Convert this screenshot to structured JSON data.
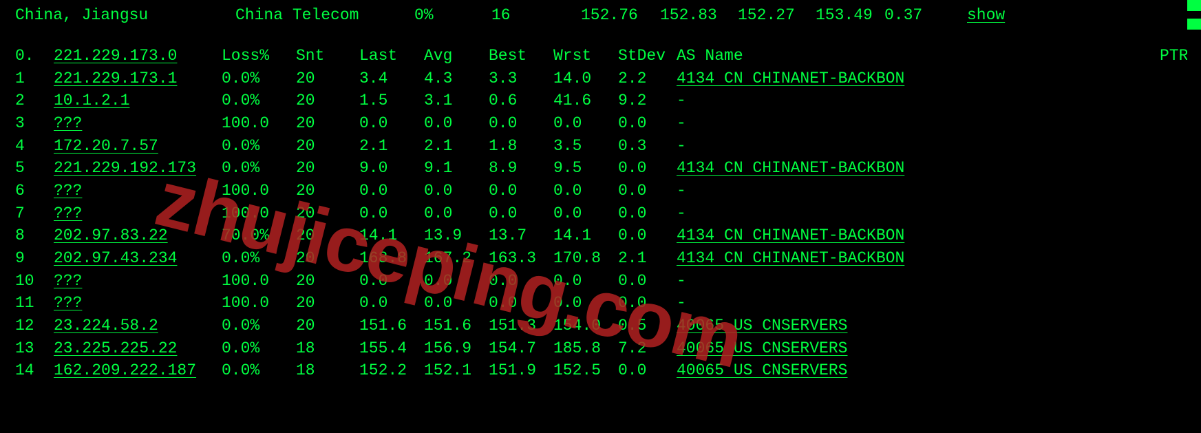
{
  "summary": {
    "location": "China, Jiangsu",
    "provider": "China Telecom",
    "loss": "0%",
    "count": "16",
    "v1": "152.76",
    "v2": "152.83",
    "v3": "152.27",
    "v4": "153.49",
    "v5": "0.37",
    "show": "show"
  },
  "headers": {
    "hop": "0.",
    "ip": "221.229.173.0",
    "loss": "Loss%",
    "snt": "Snt",
    "last": "Last",
    "avg": "Avg",
    "best": "Best",
    "wrst": "Wrst",
    "stdev": "StDev",
    "asname": "AS Name",
    "ptr": "PTR"
  },
  "rows": [
    {
      "hop": "1",
      "ip": "221.229.173.1",
      "loss": "0.0%",
      "snt": "20",
      "last": "3.4",
      "avg": "4.3",
      "best": "3.3",
      "wrst": "14.0",
      "stdev": "2.2",
      "as": "4134  CN CHINANET-BACKBON"
    },
    {
      "hop": "2",
      "ip": "10.1.2.1",
      "loss": "0.0%",
      "snt": "20",
      "last": "1.5",
      "avg": "3.1",
      "best": "0.6",
      "wrst": "41.6",
      "stdev": "9.2",
      "as": "-"
    },
    {
      "hop": "3",
      "ip": "???",
      "loss": "100.0",
      "snt": "20",
      "last": "0.0",
      "avg": "0.0",
      "best": "0.0",
      "wrst": "0.0",
      "stdev": "0.0",
      "as": "-"
    },
    {
      "hop": "4",
      "ip": "172.20.7.57",
      "loss": "0.0%",
      "snt": "20",
      "last": "2.1",
      "avg": "2.1",
      "best": "1.8",
      "wrst": "3.5",
      "stdev": "0.3",
      "as": "-"
    },
    {
      "hop": "5",
      "ip": "221.229.192.173",
      "loss": "0.0%",
      "snt": "20",
      "last": "9.0",
      "avg": "9.1",
      "best": "8.9",
      "wrst": "9.5",
      "stdev": "0.0",
      "as": "4134  CN CHINANET-BACKBON"
    },
    {
      "hop": "6",
      "ip": "???",
      "loss": "100.0",
      "snt": "20",
      "last": "0.0",
      "avg": "0.0",
      "best": "0.0",
      "wrst": "0.0",
      "stdev": "0.0",
      "as": "-"
    },
    {
      "hop": "7",
      "ip": "???",
      "loss": "100.0",
      "snt": "20",
      "last": "0.0",
      "avg": "0.0",
      "best": "0.0",
      "wrst": "0.0",
      "stdev": "0.0",
      "as": "-"
    },
    {
      "hop": "8",
      "ip": "202.97.83.22",
      "loss": "70.0%",
      "snt": "20",
      "last": "14.1",
      "avg": "13.9",
      "best": "13.7",
      "wrst": "14.1",
      "stdev": "0.0",
      "as": "4134  CN CHINANET-BACKBON"
    },
    {
      "hop": "9",
      "ip": "202.97.43.234",
      "loss": "0.0%",
      "snt": "20",
      "last": "168.8",
      "avg": "167.2",
      "best": "163.3",
      "wrst": "170.8",
      "stdev": "2.1",
      "as": "4134  CN CHINANET-BACKBON"
    },
    {
      "hop": "10",
      "ip": "???",
      "loss": "100.0",
      "snt": "20",
      "last": "0.0",
      "avg": "0.0",
      "best": "0.0",
      "wrst": "0.0",
      "stdev": "0.0",
      "as": "-"
    },
    {
      "hop": "11",
      "ip": "???",
      "loss": "100.0",
      "snt": "20",
      "last": "0.0",
      "avg": "0.0",
      "best": "0.0",
      "wrst": "0.0",
      "stdev": "0.0",
      "as": "-"
    },
    {
      "hop": "12",
      "ip": "23.224.58.2",
      "loss": "0.0%",
      "snt": "20",
      "last": "151.6",
      "avg": "151.6",
      "best": "151.3",
      "wrst": "154.0",
      "stdev": "0.5",
      "as": "40065 US CNSERVERS"
    },
    {
      "hop": "13",
      "ip": "23.225.225.22",
      "loss": "0.0%",
      "snt": "18",
      "last": "155.4",
      "avg": "156.9",
      "best": "154.7",
      "wrst": "185.8",
      "stdev": "7.2",
      "as": "40065 US CNSERVERS"
    },
    {
      "hop": "14",
      "ip": "162.209.222.187",
      "loss": "0.0%",
      "snt": "18",
      "last": "152.2",
      "avg": "152.1",
      "best": "151.9",
      "wrst": "152.5",
      "stdev": "0.0",
      "as": "40065 US CNSERVERS"
    }
  ],
  "watermark": "zhujiceping.com"
}
